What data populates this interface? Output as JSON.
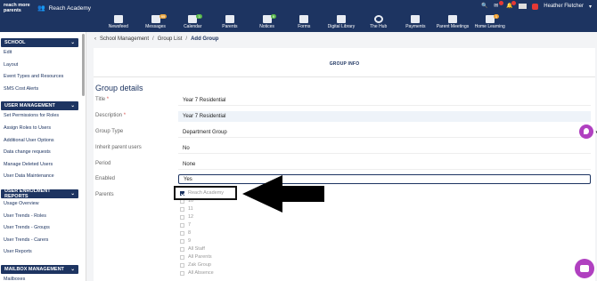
{
  "logo": {
    "line1": "reach more",
    "line2": "parents"
  },
  "school": {
    "name": "Reach Academy"
  },
  "nav": [
    {
      "label": "Newsfeed",
      "icon": "newsfeed-icon",
      "badge": ""
    },
    {
      "label": "Messages",
      "icon": "messages-icon",
      "badge": "99"
    },
    {
      "label": "Calendar",
      "icon": "calendar-icon",
      "badge": "3"
    },
    {
      "label": "Parents",
      "icon": "parents-icon",
      "badge": ""
    },
    {
      "label": "Notices",
      "icon": "notices-icon",
      "badge": "9"
    },
    {
      "label": "Forms",
      "icon": "forms-icon",
      "badge": ""
    },
    {
      "label": "Digital Library",
      "icon": "library-icon",
      "badge": ""
    },
    {
      "label": "The Hub",
      "icon": "hub-icon",
      "badge": ""
    },
    {
      "label": "Payments",
      "icon": "cart-icon",
      "badge": ""
    },
    {
      "label": "Parent Meetings",
      "icon": "meetings-icon",
      "badge": ""
    },
    {
      "label": "Home Learning",
      "icon": "home-learning-icon",
      "badge": "1"
    }
  ],
  "user": {
    "name": "Heather Fletcher"
  },
  "sidebar": {
    "sections": [
      {
        "title": "SCHOOL",
        "items": [
          "Edit",
          "Layout",
          "Event Types and Resources",
          "SMS Cost Alerts"
        ]
      },
      {
        "title": "USER MANAGEMENT",
        "items": [
          "Set Permissions for Roles",
          "Assign Roles to Users",
          "Additional User Options",
          "Data change requests",
          "Manage Deleted Users",
          "User Data Maintenance"
        ]
      },
      {
        "title": "USER ENROLMENT REPORTS",
        "items": [
          "Usage Overview",
          "User Trends - Roles",
          "User Trends - Groups",
          "User Trends - Carers",
          "User Reports"
        ]
      },
      {
        "title": "MAILBOX MANAGEMENT",
        "items": [
          "Mailboxes"
        ]
      }
    ]
  },
  "breadcrumb": [
    "School Management",
    "Group List",
    "Add Group"
  ],
  "tab": {
    "label": "GROUP INFO"
  },
  "section_title": "Group details",
  "fields": [
    {
      "label": "Title",
      "required": true,
      "value": "Year 7 Residential"
    },
    {
      "label": "Description",
      "required": true,
      "value": "Year 7 Residential"
    },
    {
      "label": "Group Type",
      "required": false,
      "value": "Department Group"
    },
    {
      "label": "Inherit parent users",
      "required": false,
      "value": "No"
    },
    {
      "label": "Period",
      "required": false,
      "value": "None"
    },
    {
      "label": "Enabled",
      "required": false,
      "value": "Yes"
    },
    {
      "label": "Parents",
      "required": false,
      "value": ""
    }
  ],
  "parents_options": [
    {
      "label": "Reach Academy",
      "checked": true
    },
    {
      "label": "10",
      "checked": false
    },
    {
      "label": "11",
      "checked": false
    },
    {
      "label": "12",
      "checked": false
    },
    {
      "label": "7",
      "checked": false
    },
    {
      "label": "8",
      "checked": false
    },
    {
      "label": "9",
      "checked": false
    },
    {
      "label": "All Staff",
      "checked": false
    },
    {
      "label": "All Parents",
      "checked": false
    },
    {
      "label": "Zak Group",
      "checked": false
    },
    {
      "label": "All Absence",
      "checked": false
    }
  ],
  "colors": {
    "brand": "#1d3461",
    "accent": "#b040c0",
    "required": "#d9534f"
  }
}
